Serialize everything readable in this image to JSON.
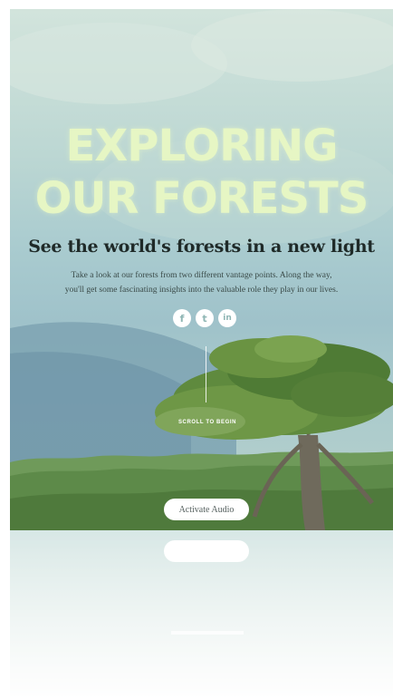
{
  "hero": {
    "title_line1": "EXPLORING",
    "title_line2": "OUR FORESTS",
    "subtitle": "See the world's forests in a new light",
    "intro_line1": "Take a look at our forests from two different vantage points. Along the way,",
    "intro_line2": "you'll get some fascinating insights into the valuable role they play in our lives."
  },
  "social": [
    {
      "icon": "facebook-icon",
      "glyph": "f"
    },
    {
      "icon": "twitter-icon",
      "glyph": "t"
    },
    {
      "icon": "linkedin-icon",
      "glyph": "in"
    }
  ],
  "scroll": {
    "label": "SCROLL TO BEGIN"
  },
  "cta": {
    "label": "Activate Audio"
  },
  "colors": {
    "title": "#e6f6c4",
    "subtitle": "#1f2a28",
    "sky": "#bcd7d3",
    "foliage": "#5f8a3e"
  }
}
